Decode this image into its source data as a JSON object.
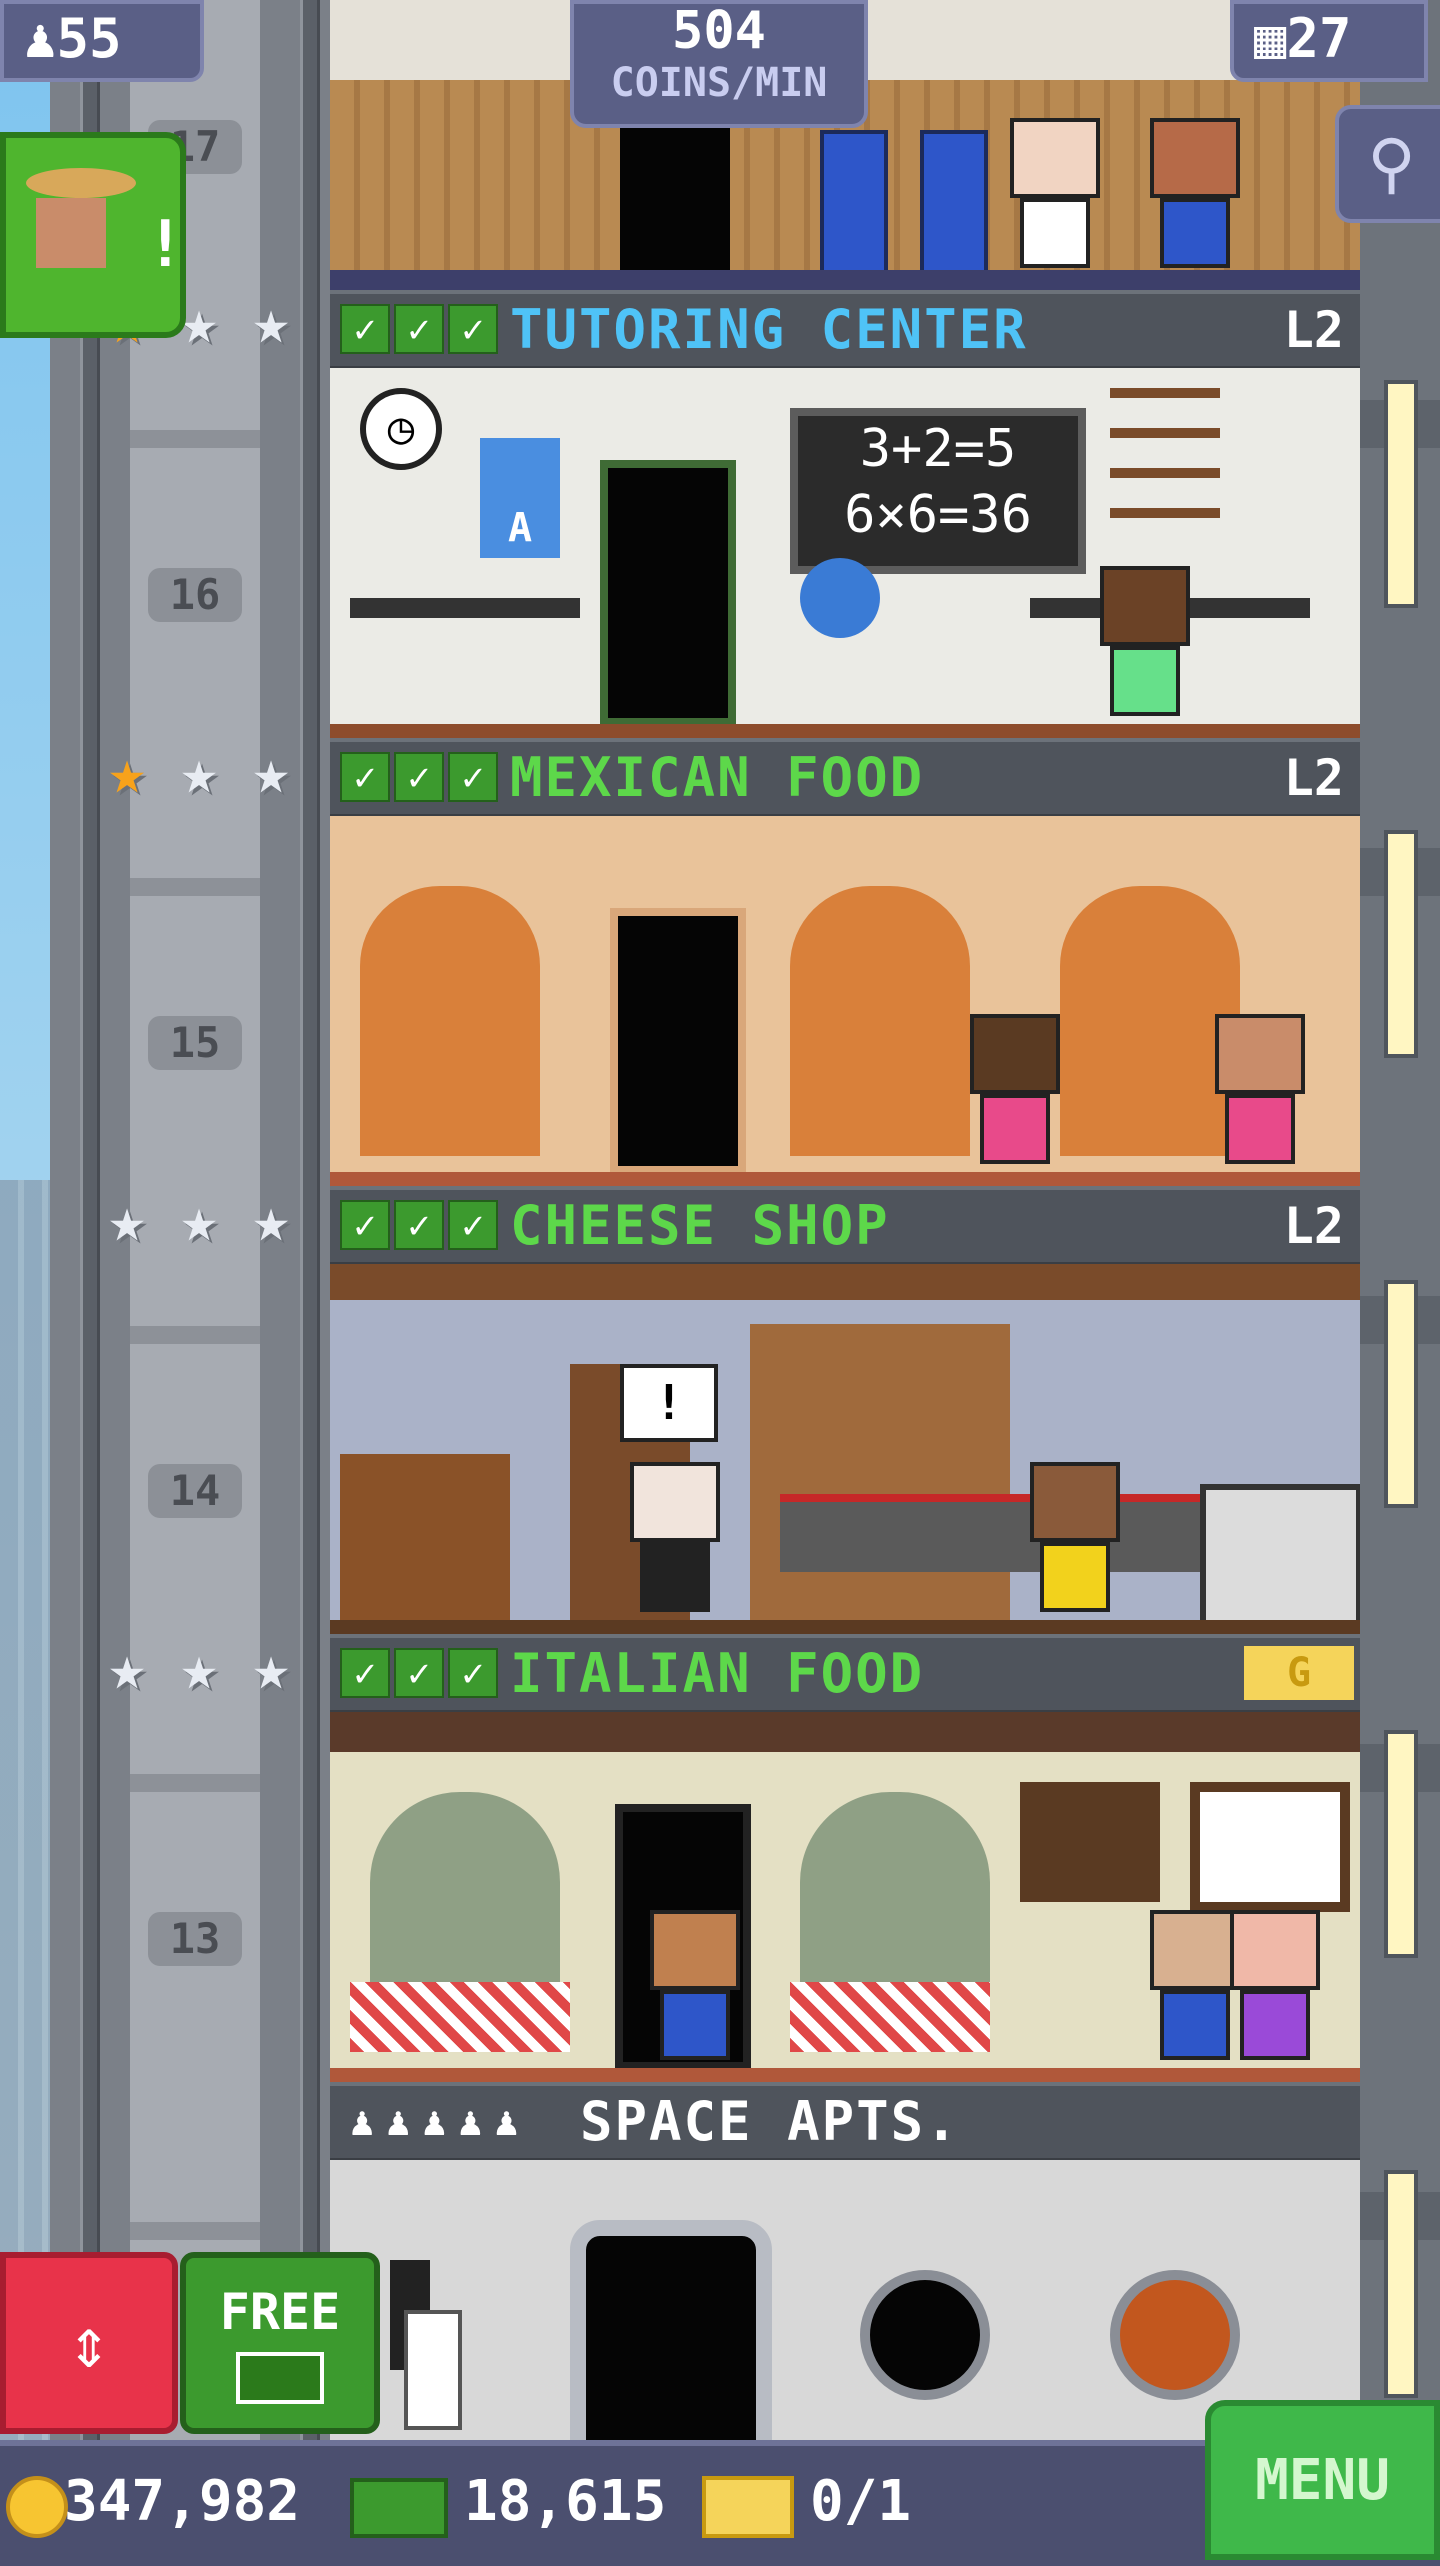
{
  "hud": {
    "population": "55",
    "population_icon": "person-icon",
    "income_value": "504",
    "income_unit": "COINS/MIN",
    "floors_count": "27",
    "floors_icon": "building-icon"
  },
  "floors": [
    {
      "number": "17",
      "name": "",
      "level": "",
      "stars_gold": 0
    },
    {
      "number": "16",
      "name": "TUTORING CENTER",
      "level": "L2",
      "name_color": "#4fc3f7",
      "stars_gold": 1,
      "chalkboard": [
        "3+2=5",
        "6×6=36"
      ],
      "poster_letter": "A"
    },
    {
      "number": "15",
      "name": "MEXICAN FOOD",
      "level": "L2",
      "name_color": "#5dd84a",
      "stars_gold": 1
    },
    {
      "number": "14",
      "name": "CHEESE SHOP",
      "level": "L2",
      "name_color": "#5dd84a",
      "stars_gold": 0,
      "speech_bubble": "!"
    },
    {
      "number": "13",
      "name": "ITALIAN FOOD",
      "level": "",
      "level_badge": "G",
      "name_color": "#5dd84a",
      "stars_gold": 0
    },
    {
      "number": "",
      "name": "SPACE APTS.",
      "name_color": "#ffffff",
      "residents_icon": "resident-icon",
      "residents_count": 5
    }
  ],
  "controls": {
    "elevator_icon": "elevator-arrows-icon",
    "free_label": "FREE",
    "free_icon": "bux-icon",
    "menu_label": "MENU"
  },
  "currency": {
    "coins": "347,982",
    "coin_icon": "coin-icon",
    "bux": "18,615",
    "bux_icon": "bux-icon",
    "tickets": "0/1",
    "ticket_icon": "golden-ticket-icon"
  },
  "colors": {
    "accent_green": "#3c9a2e",
    "elevator_red": "#e8334a",
    "hud_purple": "#5a5f86"
  }
}
